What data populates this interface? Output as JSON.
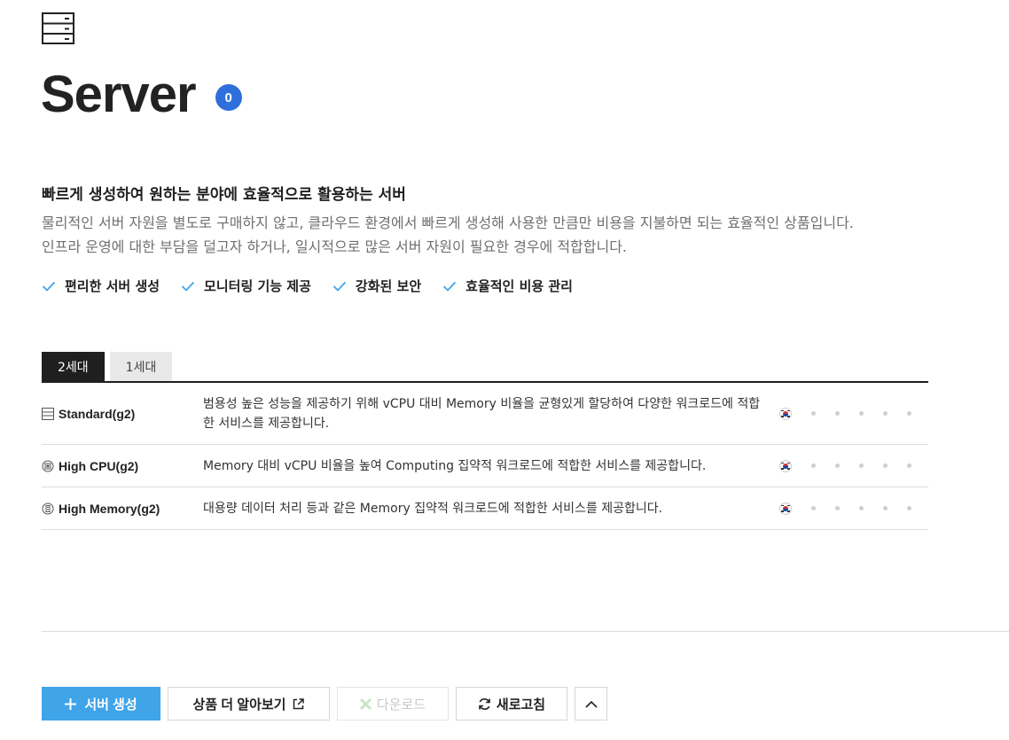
{
  "header": {
    "title": "Server",
    "count": "0"
  },
  "intro": {
    "headline": "빠르게 생성하여 원하는 분야에 효율적으로 활용하는 서버",
    "desc_line1": "물리적인 서버 자원을 별도로 구매하지 않고, 클라우드 환경에서 빠르게 생성해 사용한 만큼만 비용을 지불하면 되는 효율적인 상품입니다.",
    "desc_line2": "인프라 운영에 대한 부담을 덜고자 하거나, 일시적으로 많은 서버 자원이 필요한 경우에 적합합니다."
  },
  "features": [
    "편리한 서버 생성",
    "모니터링 기능 제공",
    "강화된 보안",
    "효율적인 비용 관리"
  ],
  "tabs": [
    {
      "label": "2세대",
      "active": true
    },
    {
      "label": "1세대",
      "active": false
    }
  ],
  "products": [
    {
      "name": "Standard(g2)",
      "icon": "standard-server-icon",
      "desc": "범용성 높은 성능을 제공하기 위해 vCPU 대비 Memory 비율을 균형있게 할당하여 다양한 워크로드에 적합한 서비스를 제공합니다."
    },
    {
      "name": "High CPU(g2)",
      "icon": "cpu-icon",
      "desc": "Memory 대비 vCPU 비율을 높여 Computing 집약적 워크로드에 적합한 서비스를 제공합니다."
    },
    {
      "name": "High Memory(g2)",
      "icon": "memory-icon",
      "desc": "대용량 데이터 처리 등과 같은 Memory 집약적 워크로드에 적합한 서비스를 제공합니다."
    }
  ],
  "actions": {
    "create": "서버 생성",
    "learn_more": "상품 더 알아보기",
    "download": "다운로드",
    "refresh": "새로고침"
  },
  "colors": {
    "accent": "#3fa4e8",
    "badge": "#2f6fdc",
    "check": "#3fa4e8"
  }
}
